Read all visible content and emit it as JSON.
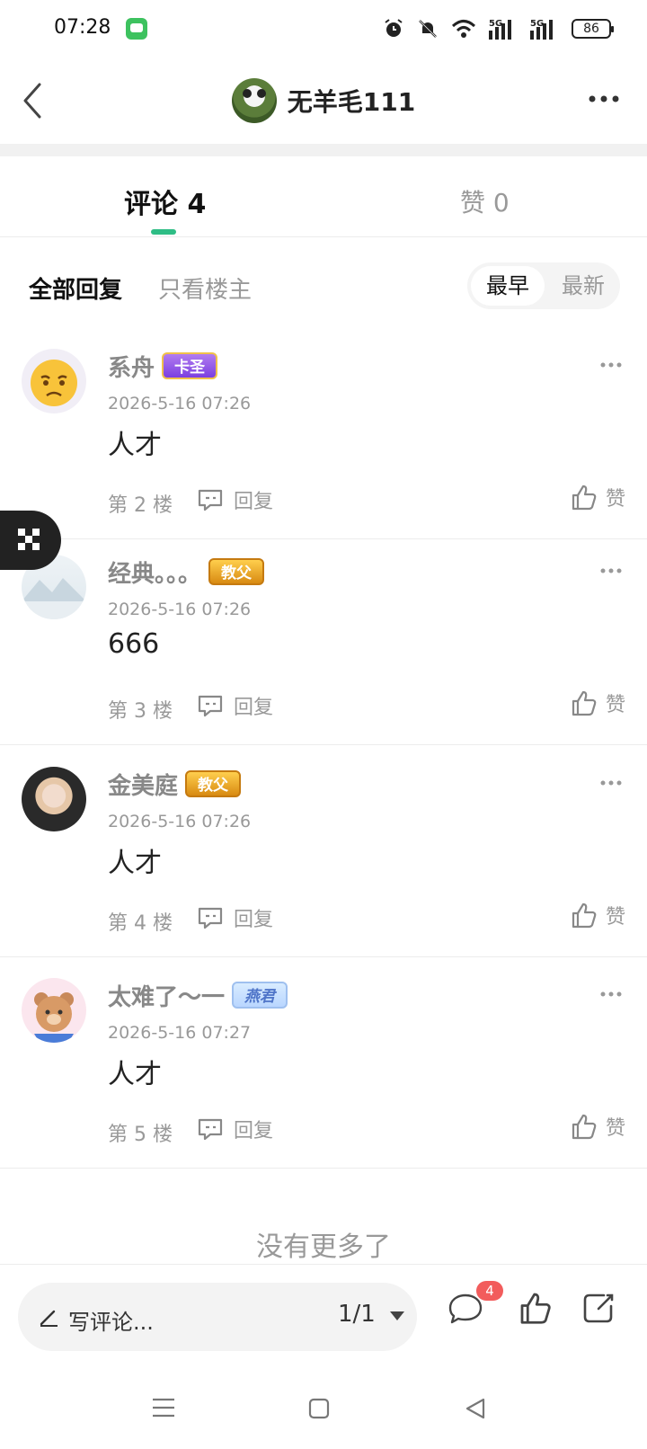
{
  "status_bar": {
    "time": "07:28",
    "battery": "86",
    "signal_1": "5G",
    "signal_2": "5G"
  },
  "navbar": {
    "title": "无羊毛111"
  },
  "tabs": {
    "comments": "评论 4",
    "likes": "赞 0"
  },
  "filters": {
    "all": "全部回复",
    "op_only": "只看楼主",
    "sort_earliest": "最早",
    "sort_newest": "最新"
  },
  "comments": [
    {
      "name": "系舟",
      "badge": "卡圣",
      "time": "2026-5-16 07:26",
      "text": "人才",
      "floor": "第 2 楼",
      "reply": "回复",
      "like": "赞"
    },
    {
      "name": "经典。。。",
      "badge": "教父",
      "time": "2026-5-16 07:26",
      "text": "666",
      "floor": "第 3 楼",
      "reply": "回复",
      "like": "赞"
    },
    {
      "name": "金美庭",
      "badge": "教父",
      "time": "2026-5-16 07:26",
      "text": "人才",
      "floor": "第 4 楼",
      "reply": "回复",
      "like": "赞"
    },
    {
      "name": "太难了～一",
      "badge": "燕君",
      "time": "2026-5-16 07:27",
      "text": "人才",
      "floor": "第 5 楼",
      "reply": "回复",
      "like": "赞"
    }
  ],
  "footer": {
    "no_more": "没有更多了",
    "write_comment": "写评论...",
    "page": "1/1",
    "comment_count_badge": "4"
  },
  "colors": {
    "accent": "#2ebd85",
    "badge_red": "#f25c5c"
  }
}
